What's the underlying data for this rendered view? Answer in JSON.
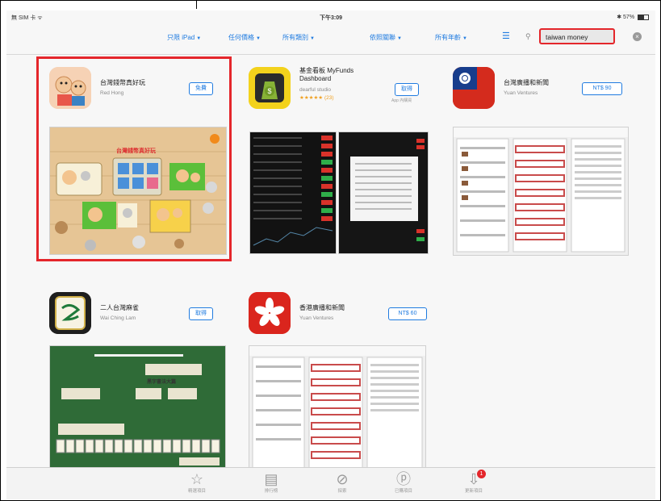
{
  "status_bar": {
    "carrier": "無 SIM 卡 ᯤ",
    "time": "下午3:09",
    "battery": "57%",
    "battery_level": 0.57
  },
  "filters": [
    {
      "label": "只限 iPad"
    },
    {
      "label": "任何價格"
    },
    {
      "label": "所有類別"
    },
    {
      "label": "依照關聯"
    },
    {
      "label": "所有年齡"
    }
  ],
  "search": {
    "query": "taiwan money"
  },
  "apps": [
    {
      "name": "台灣錢幣真好玩",
      "developer": "Red Hong",
      "action": "免費",
      "highlighted": true
    },
    {
      "name": "基金看板 MyFunds Dashboard",
      "developer": "dearful studio",
      "rating": "★★★★★ (23)",
      "action": "取得",
      "action_sub": "App 內購買"
    },
    {
      "name": "台灣廣播和新聞",
      "developer": "Yuan Ventures",
      "action": "NT$ 90"
    },
    {
      "name": "二人台灣麻雀",
      "developer": "Wai Ching Lam",
      "action": "取得"
    },
    {
      "name": "香港廣播和新聞",
      "developer": "Yuan Ventures",
      "action": "NT$ 60"
    }
  ],
  "shot_titles": {
    "coins_game": "台灣錢幣真好玩",
    "mahjong_banner": "黑字書法大篇"
  },
  "tabs": [
    {
      "label": "精選項目",
      "icon": "star-icon"
    },
    {
      "label": "排行榜",
      "icon": "list-grid-icon"
    },
    {
      "label": "探索",
      "icon": "compass-icon"
    },
    {
      "label": "已購項目",
      "icon": "purchased-icon"
    },
    {
      "label": "更新項目",
      "icon": "updates-icon",
      "badge": "1"
    }
  ],
  "colors": {
    "accent": "#1f7be0",
    "highlight": "#e4262b"
  }
}
